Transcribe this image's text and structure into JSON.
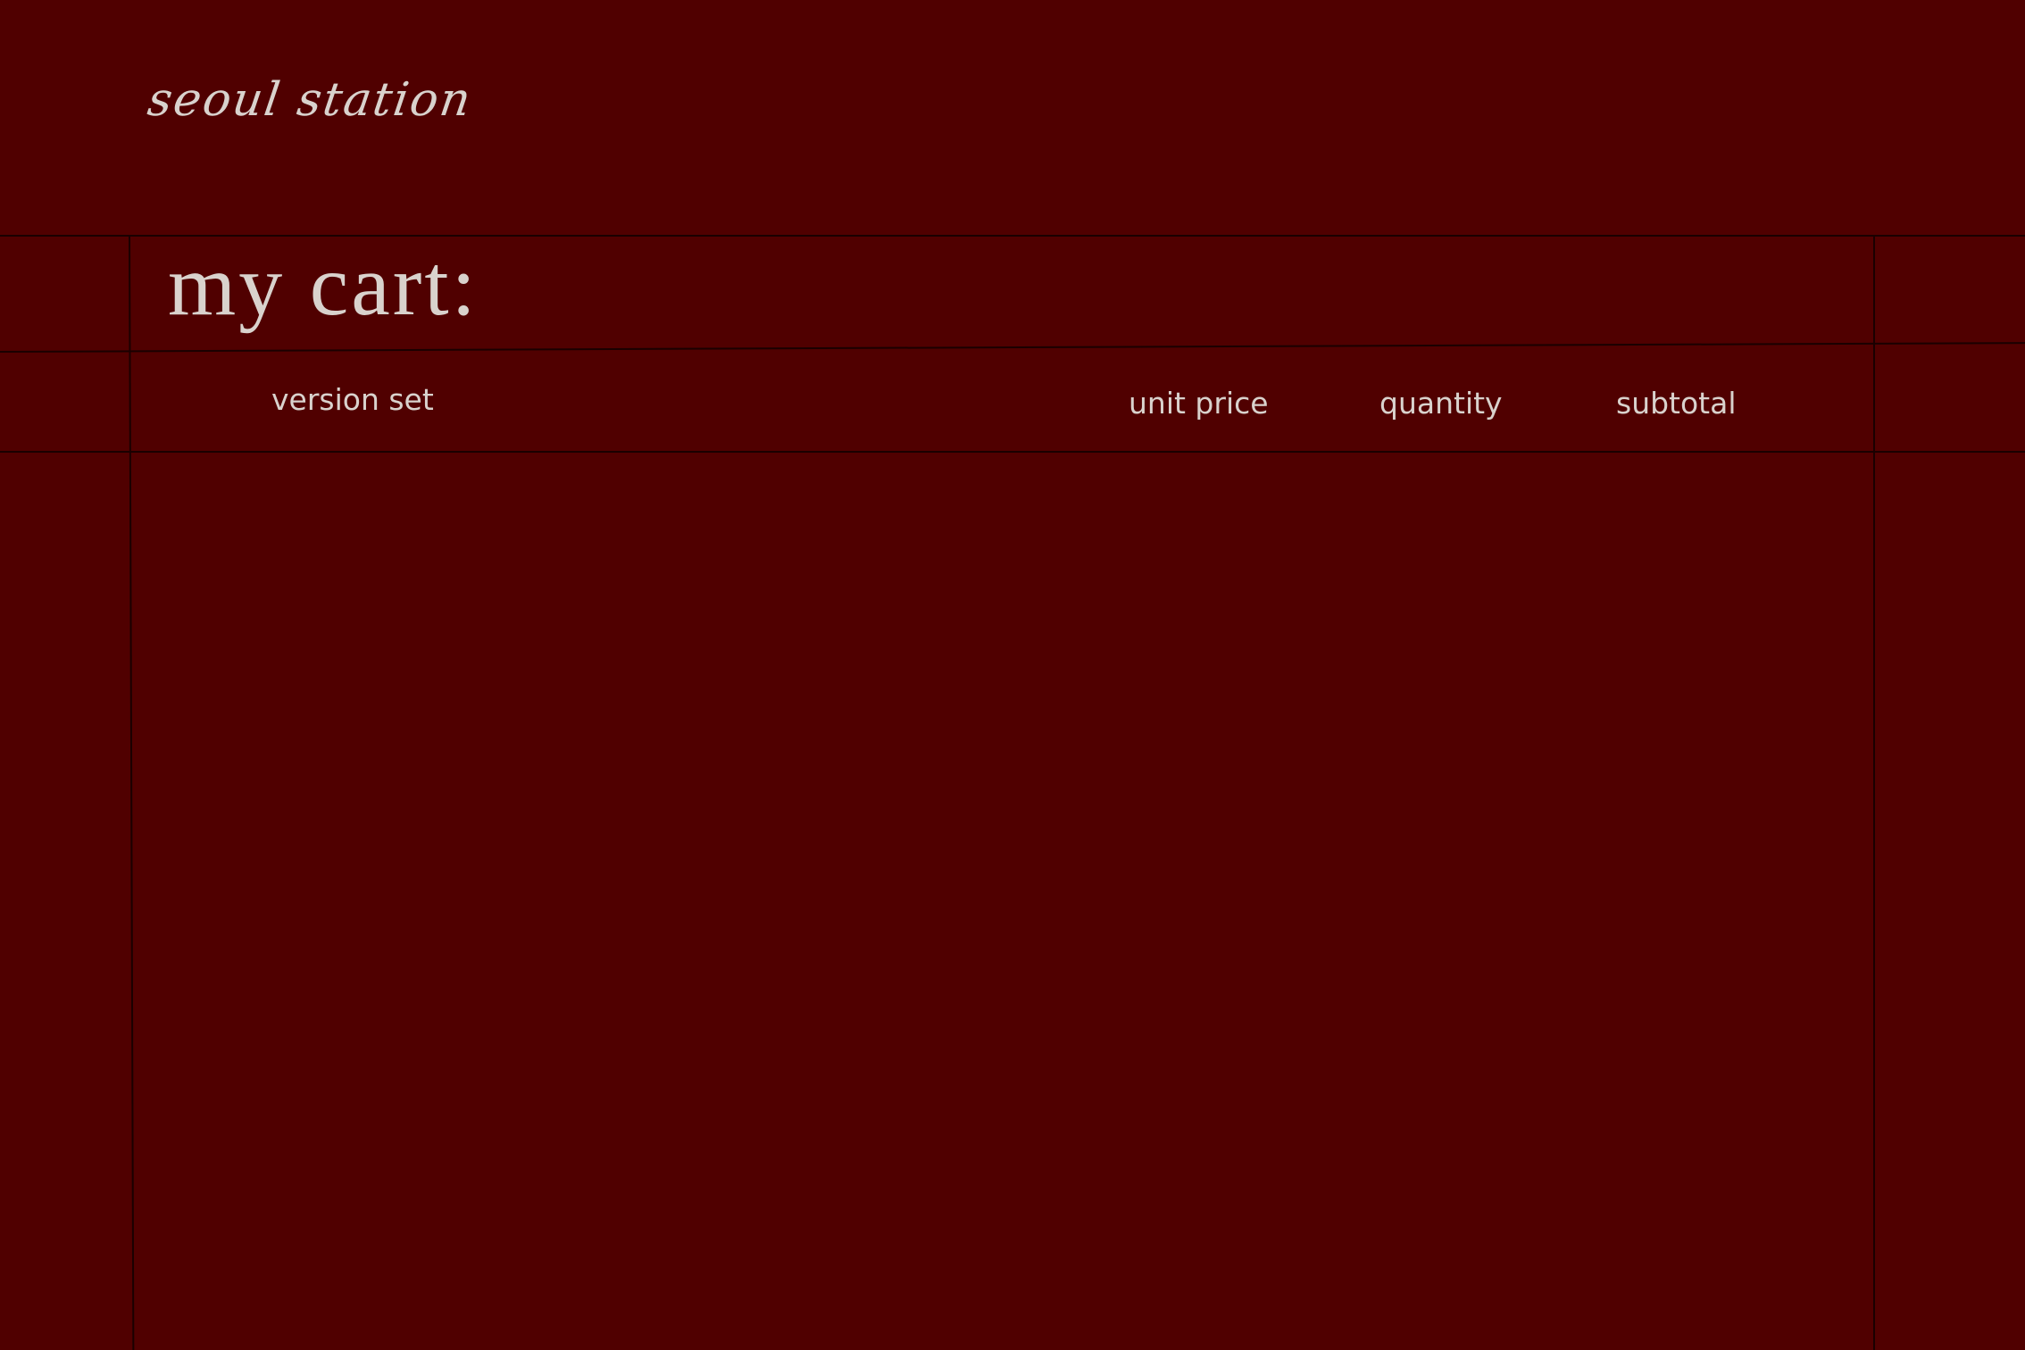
{
  "brand": {
    "name": "seoul station"
  },
  "cart": {
    "title": "my cart:",
    "columns": [
      {
        "id": "item",
        "label": "version set"
      },
      {
        "id": "unit_price",
        "label": "unit price"
      },
      {
        "id": "quantity",
        "label": "quantity"
      },
      {
        "id": "subtotal",
        "label": "subtotal"
      }
    ],
    "items": []
  },
  "colors": {
    "background": "#500000",
    "text": "#d9d2cd",
    "grid_lines": "#1a0000"
  }
}
